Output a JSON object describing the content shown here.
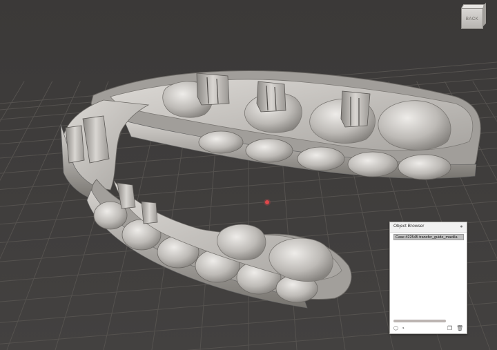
{
  "viewport": {
    "background": "#3e3c3b",
    "grid_color": "#55524f",
    "model_color": "#bdbab6",
    "pivot_color": "#e0494b"
  },
  "view_cube": {
    "face_label": "BACK"
  },
  "object_browser": {
    "title": "Object Browser",
    "close_icon": "close-icon",
    "items": [
      {
        "label": "Case #22545 transfer_guide_maxilla",
        "selected": true
      }
    ],
    "footer_icons": [
      "cube-icon",
      "eye-icon",
      "duplicate-icon",
      "trash-icon"
    ]
  }
}
